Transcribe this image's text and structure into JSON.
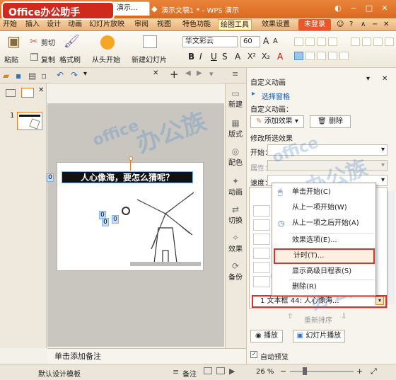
{
  "app": {
    "logo": "Office办公助手",
    "title": "演示文稿1 * - WPS 演示"
  },
  "menu": {
    "items": [
      "开始",
      "插入",
      "设计",
      "动画",
      "幻灯片放映",
      "审阅",
      "视图",
      "特色功能",
      "绘图工具",
      "效果设置"
    ],
    "login": "未登录"
  },
  "ribbon": {
    "paste": "粘贴",
    "cut": "剪切",
    "copy": "复制",
    "format_painter": "格式刷",
    "from_start": "从头开始",
    "new_slide": "新建幻灯片",
    "font_name": "华文彩云",
    "font_size": "60"
  },
  "doc_tab": "演示...",
  "thumbnail": {
    "number": "1"
  },
  "slide": {
    "title": "人心像海，要怎么猜呢？",
    "tags": [
      "0",
      "0",
      "0"
    ]
  },
  "side_tabs": [
    "新建",
    "版式",
    "配色",
    "动画",
    "切换",
    "效果",
    "备份"
  ],
  "pane": {
    "title": "自定义动画",
    "select_pane": "选择窗格",
    "custom_anim_label": "自定义动画：",
    "add_effect": "添加效果",
    "delete": "删除",
    "modify_label": "修改所选效果",
    "start_label": "开始：",
    "property_label": "属性：",
    "speed_label": "速度：",
    "item": "1  文本框 44: 人心像海...",
    "reorder": "重新排序",
    "play": "播放",
    "slideshow": "幻灯片播放",
    "auto_preview": "自动预览"
  },
  "context_menu": {
    "items": [
      {
        "label": "单击开始(C)",
        "icon": "mouse-icon"
      },
      {
        "label": "从上一项开始(W)",
        "icon": "none"
      },
      {
        "label": "从上一项之后开始(A)",
        "icon": "clock-icon"
      },
      {
        "label": "效果选项(E)...",
        "icon": "none"
      },
      {
        "label": "计时(T)...",
        "icon": "none"
      },
      {
        "label": "显示高级日程表(S)",
        "icon": "none"
      },
      {
        "label": "删除(R)",
        "icon": "none"
      }
    ]
  },
  "notes": "单击添加备注",
  "status": {
    "template": "默认设计模板",
    "notes": "备注",
    "zoom": "26 %"
  },
  "colors": {
    "accent": "#e8843a",
    "highlight": "#d8322a"
  }
}
